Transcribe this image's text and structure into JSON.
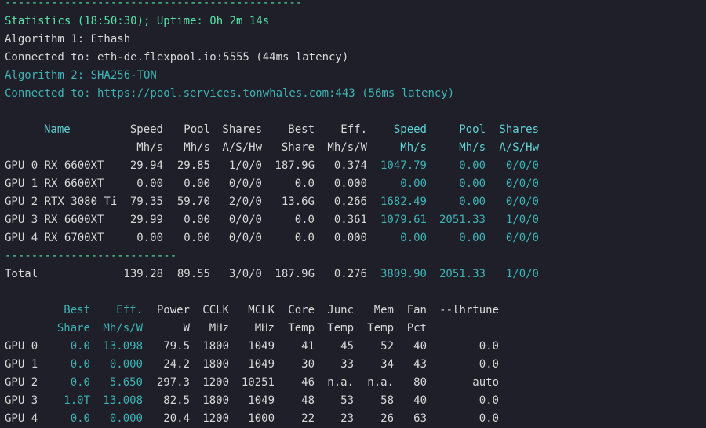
{
  "colors": {
    "background": "#1e1f29",
    "green": "#56e3a6",
    "white": "#d8d8d8",
    "cyan": "#3cb4b4",
    "cyan_header": "#5fd3d3"
  },
  "top_dashes": "---------------------------------------------",
  "stats_line": "Statistics (18:50:30); Uptime: 0h 2m 14s",
  "alg1_line": "Algorithm 1: Ethash",
  "conn1_line": "Connected to: eth-de.flexpool.io:5555 (44ms latency)",
  "alg2_line": "Algorithm 2: SHA256-TON",
  "conn2_line": "Connected to: https://pool.services.tonwhales.com:443 (56ms latency)",
  "table1": {
    "header1": [
      "Name",
      "Speed",
      "Pool",
      "Shares",
      "Best",
      "Eff.",
      "Speed",
      "Pool",
      "Shares"
    ],
    "header2": [
      "",
      "Mh/s",
      "Mh/s",
      "A/S/Hw",
      "Share",
      "Mh/s/W",
      "Mh/s",
      "Mh/s",
      "A/S/Hw"
    ],
    "rows": [
      [
        "GPU 0 RX 6600XT",
        "29.94",
        "29.85",
        "1/0/0",
        "187.9G",
        "0.374",
        "1047.79",
        "0.00",
        "0/0/0"
      ],
      [
        "GPU 1 RX 6600XT",
        "0.00",
        "0.00",
        "0/0/0",
        "0.0",
        "0.000",
        "0.00",
        "0.00",
        "0/0/0"
      ],
      [
        "GPU 2 RTX 3080 Ti",
        "79.35",
        "59.70",
        "2/0/0",
        "13.6G",
        "0.266",
        "1682.49",
        "0.00",
        "0/0/0"
      ],
      [
        "GPU 3 RX 6600XT",
        "29.99",
        "0.00",
        "0/0/0",
        "0.0",
        "0.361",
        "1079.61",
        "2051.33",
        "1/0/0"
      ],
      [
        "GPU 4 RX 6700XT",
        "0.00",
        "0.00",
        "0/0/0",
        "0.0",
        "0.000",
        "0.00",
        "0.00",
        "0/0/0"
      ]
    ],
    "separator": "--------------------------",
    "total": [
      "Total",
      "139.28",
      "89.55",
      "3/0/0",
      "187.9G",
      "0.276",
      "3809.90",
      "2051.33",
      "1/0/0"
    ]
  },
  "table2": {
    "header1": [
      "Best",
      "Eff.",
      "Power",
      "CCLK",
      "MCLK",
      "Core",
      "Junc",
      "Mem",
      "Fan",
      "--lhrtune"
    ],
    "header2": [
      "Share",
      "Mh/s/W",
      "W",
      "MHz",
      "MHz",
      "Temp",
      "Temp",
      "Temp",
      "Pct",
      ""
    ],
    "rows": [
      [
        "GPU 0",
        "0.0",
        "13.098",
        "79.5",
        "1800",
        "1049",
        "41",
        "45",
        "52",
        "40",
        "0.0"
      ],
      [
        "GPU 1",
        "0.0",
        "0.000",
        "24.2",
        "1800",
        "1049",
        "30",
        "33",
        "34",
        "43",
        "0.0"
      ],
      [
        "GPU 2",
        "0.0",
        "5.650",
        "297.3",
        "1200",
        "10251",
        "46",
        "n.a.",
        "n.a.",
        "80",
        "auto"
      ],
      [
        "GPU 3",
        "1.0T",
        "13.008",
        "82.5",
        "1800",
        "1049",
        "48",
        "53",
        "58",
        "40",
        "0.0"
      ],
      [
        "GPU 4",
        "0.0",
        "0.000",
        "20.4",
        "1200",
        "1000",
        "22",
        "23",
        "26",
        "63",
        "0.0"
      ]
    ]
  }
}
